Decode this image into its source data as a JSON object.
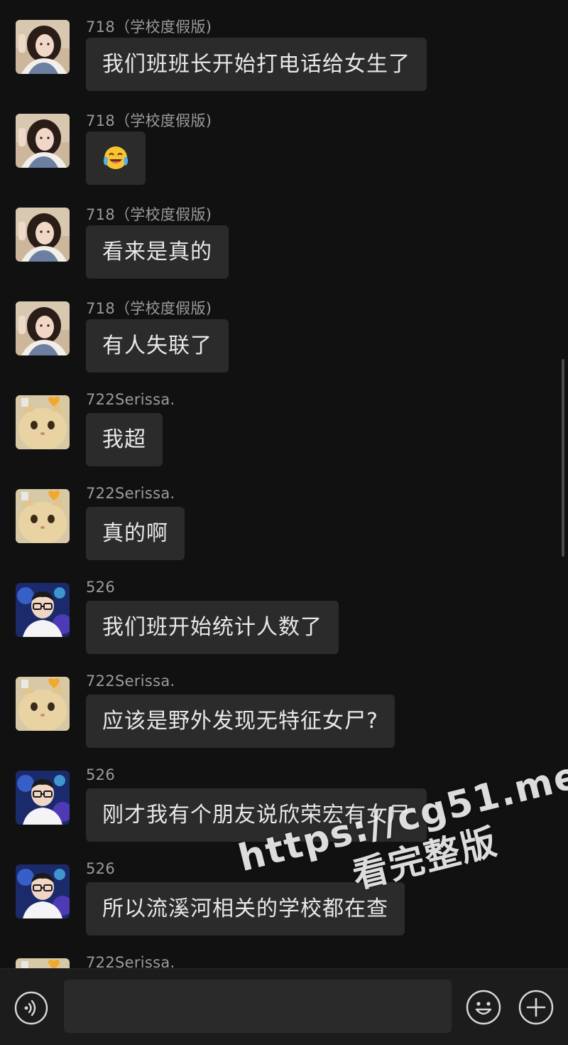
{
  "messages": [
    {
      "sender": "718（学校度假版)",
      "text": "我们班班长开始打电话给女生了",
      "avatar": "girl-avatar"
    },
    {
      "sender": "718（学校度假版)",
      "text": "",
      "emoji": "laughing-crying-emoji",
      "avatar": "girl-avatar"
    },
    {
      "sender": "718（学校度假版)",
      "text": "看来是真的",
      "avatar": "girl-avatar"
    },
    {
      "sender": "718（学校度假版)",
      "text": "有人失联了",
      "avatar": "girl-avatar"
    },
    {
      "sender": "722Serissa.",
      "text": "我超",
      "avatar": "cat-avatar"
    },
    {
      "sender": "722Serissa.",
      "text": "真的啊",
      "avatar": "cat-avatar"
    },
    {
      "sender": "526",
      "text": "我们班开始统计人数了",
      "avatar": "glasses-boy-avatar"
    },
    {
      "sender": "722Serissa.",
      "text": "应该是野外发现无特征女尸?",
      "avatar": "cat-avatar"
    },
    {
      "sender": "526",
      "text": "刚才我有个朋友说欣荣宏有女尸",
      "avatar": "glasses-boy-avatar"
    },
    {
      "sender": "526",
      "text": "所以流溪河相关的学校都在查",
      "avatar": "glasses-boy-avatar"
    },
    {
      "sender": "722Serissa.",
      "text": "",
      "avatar": "cat-avatar"
    }
  ],
  "watermark": {
    "url": "https://cg51.me",
    "subtitle": "看完整版"
  },
  "input_bar": {
    "voice_icon": "voice-icon",
    "emoji_icon": "smiley-face-icon",
    "plus_icon": "plus-icon",
    "input_value": ""
  },
  "colors": {
    "background": "#111112",
    "bubble": "#2b2b2c",
    "sender_text": "#9b9b9b",
    "message_text": "#e8e8e8"
  }
}
